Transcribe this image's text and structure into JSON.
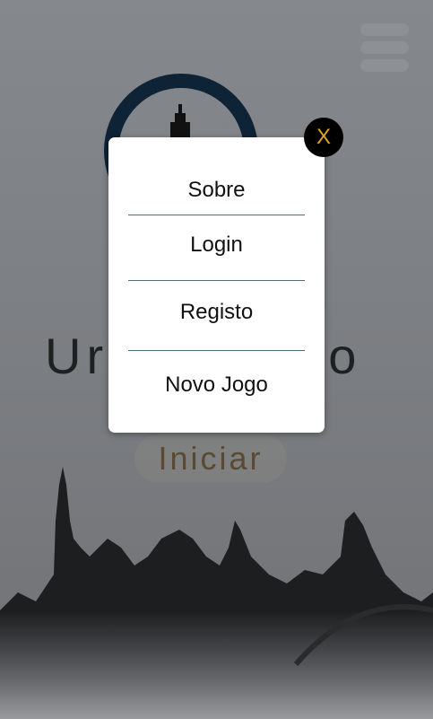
{
  "app": {
    "title_left": "Ur",
    "title_right": "rto",
    "start_label": "Iniciar"
  },
  "menu": {
    "items": [
      {
        "label": "Sobre"
      },
      {
        "label": "Login"
      },
      {
        "label": "Registo"
      },
      {
        "label": "Novo Jogo"
      }
    ],
    "close_label": "X"
  },
  "colors": {
    "accent": "#e3a322",
    "ring": "#0e2336",
    "divider": "#4d6b7d"
  }
}
